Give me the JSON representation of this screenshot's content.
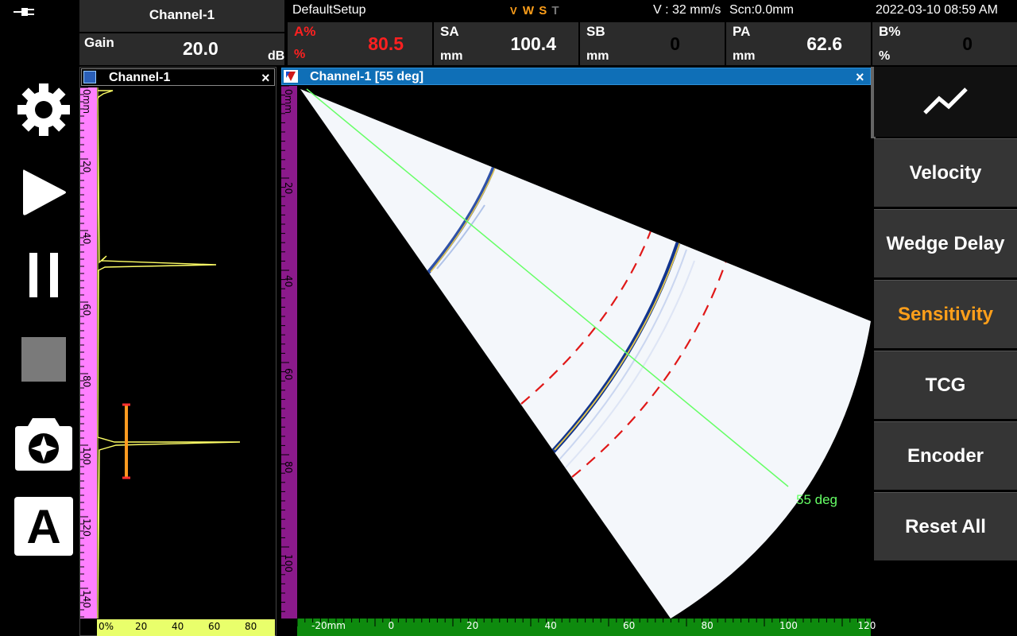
{
  "header": {
    "channel_name": "Channel-1",
    "gain_label": "Gain",
    "gain_value": "20.0",
    "gain_unit": "dB",
    "setup_name": "DefaultSetup",
    "flags": [
      "V",
      "W",
      "S",
      "T"
    ],
    "velocity": "V : 32 mm/s",
    "scan": "Scn:0.0mm",
    "datetime": "2022-03-10 08:59 AM",
    "readouts": [
      {
        "label": "A%",
        "unit": "%",
        "value": "80.5",
        "color": "#ff2020"
      },
      {
        "label": "SA",
        "unit": "mm",
        "value": "100.4",
        "color": "#ffffff"
      },
      {
        "label": "SB",
        "unit": "mm",
        "value": "0",
        "color": "#000000"
      },
      {
        "label": "PA",
        "unit": "mm",
        "value": "62.6",
        "color": "#ffffff"
      },
      {
        "label": "B%",
        "unit": "%",
        "value": "0",
        "color": "#000000"
      }
    ]
  },
  "ascan": {
    "title": "Channel-1",
    "close": "×",
    "depth_ticks": [
      "0mm",
      "20",
      "40",
      "60",
      "80",
      "100",
      "120",
      "140"
    ],
    "amp_ticks": [
      "0%",
      "20",
      "40",
      "60",
      "80"
    ]
  },
  "sscan": {
    "title": "Channel-1 [55 deg]",
    "close": "×",
    "depth_ticks": [
      "0mm",
      "20",
      "40",
      "60",
      "80",
      "100"
    ],
    "index_ticks": [
      "-20mm",
      "0",
      "20",
      "40",
      "60",
      "80",
      "100",
      "120"
    ],
    "angle_label": "55 deg"
  },
  "left_tools": [
    {
      "name": "settings",
      "icon": "gear-icon"
    },
    {
      "name": "play",
      "icon": "play-icon"
    },
    {
      "name": "pause",
      "icon": "pause-icon"
    },
    {
      "name": "stop",
      "icon": "stop-icon"
    },
    {
      "name": "snapshot",
      "icon": "camera-icon"
    },
    {
      "name": "auto",
      "icon": "letter-a-icon",
      "text": "A"
    }
  ],
  "top_status_icon": "plug-icon",
  "menu": {
    "items": [
      "Velocity",
      "Wedge Delay",
      "Sensitivity",
      "TCG",
      "Encoder",
      "Reset All"
    ],
    "active": "Sensitivity",
    "active_color": "#ff9f1a"
  },
  "colors": {
    "ascan_depth_ruler": "#ff80ff",
    "ascan_amp_ruler": "#e9ff6b",
    "sscan_depth_ruler": "#8b1a8b",
    "sscan_index_ruler": "#0e8a0e",
    "title_bar_active": "#0f6fb7",
    "signal": "#ffff66",
    "gate": "#ff3030",
    "beam": "#66ff66"
  }
}
